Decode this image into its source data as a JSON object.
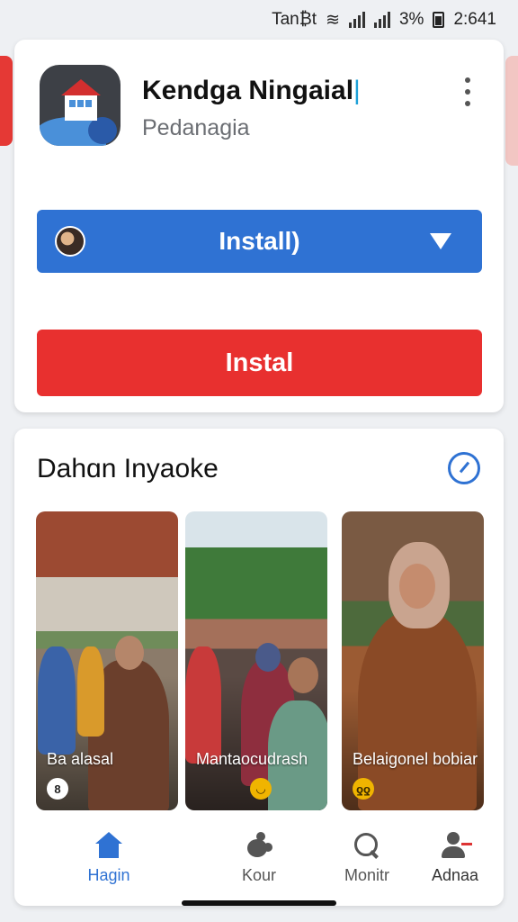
{
  "status_bar": {
    "carrier": "Tan₿t",
    "battery": "3%",
    "time": "2:641"
  },
  "app": {
    "title": "Kendga Ningaial",
    "cursor": "|",
    "subtitle": "Pedanagia",
    "icon": "house-wave-app-icon"
  },
  "actions": {
    "primary_install_label": "Install)",
    "secondary_install_label": "Instal"
  },
  "section": {
    "title": "Dahɑn Inyaoke",
    "icon": "check-circle-icon"
  },
  "photos": [
    {
      "caption": "Ba alasal",
      "badge": "8"
    },
    {
      "caption": "Mantaocudrash",
      "badge": "◡"
    },
    {
      "caption": "Belaigonel bobiar",
      "badge": "ƍƍ"
    }
  ],
  "nav": {
    "items": [
      {
        "label": "Hagin",
        "icon": "home-icon"
      },
      {
        "label": "Kour",
        "icon": "puzzle-icon"
      },
      {
        "label": "Monitr",
        "icon": "search-icon"
      },
      {
        "label": "Adnaa",
        "icon": "person-icon"
      }
    ]
  },
  "colors": {
    "primary_blue": "#2f72d3",
    "install_red": "#e8302f",
    "background": "#eef0f3"
  }
}
